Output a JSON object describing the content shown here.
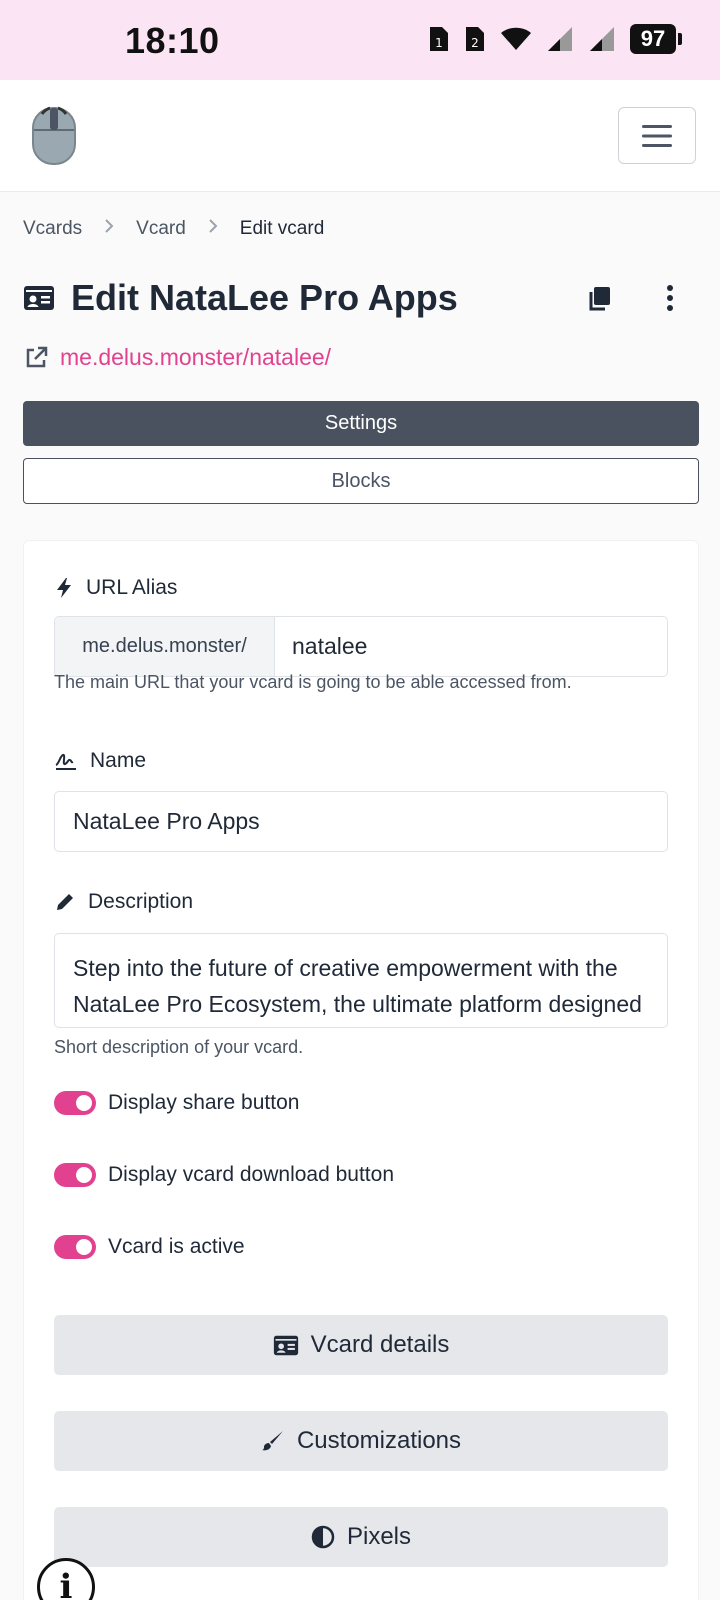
{
  "status_bar": {
    "time": "18:10",
    "battery": "97"
  },
  "navbar": {
    "logo": "mouse-logo",
    "menu_icon": "hamburger-icon"
  },
  "breadcrumb": [
    {
      "label": "Vcards"
    },
    {
      "label": "Vcard"
    },
    {
      "label": "Edit vcard"
    }
  ],
  "page": {
    "title": "Edit NataLee Pro Apps",
    "url": "me.delus.monster/natalee/"
  },
  "tabs": {
    "settings": "Settings",
    "blocks": "Blocks"
  },
  "form": {
    "url_alias": {
      "label": "URL Alias",
      "prefix": "me.delus.monster/",
      "value": "natalee",
      "help": "The main URL that your vcard is going to be able accessed from."
    },
    "name": {
      "label": "Name",
      "value": "NataLee Pro Apps"
    },
    "description": {
      "label": "Description",
      "value": "Step into the future of creative empowerment with the NataLee Pro Ecosystem, the ultimate platform designed to inspire and empower creators of nurturing",
      "help": "Short description of your vcard."
    },
    "toggles": [
      {
        "label": "Display share button",
        "on": true
      },
      {
        "label": "Display vcard download button",
        "on": true
      },
      {
        "label": "Vcard is active",
        "on": true
      }
    ],
    "buttons": {
      "details": "Vcard details",
      "customizations": "Customizations",
      "pixels": "Pixels"
    }
  },
  "colors": {
    "accent": "#e2418f",
    "dark": "#4a5260",
    "status_bg": "#fbe4f3"
  }
}
